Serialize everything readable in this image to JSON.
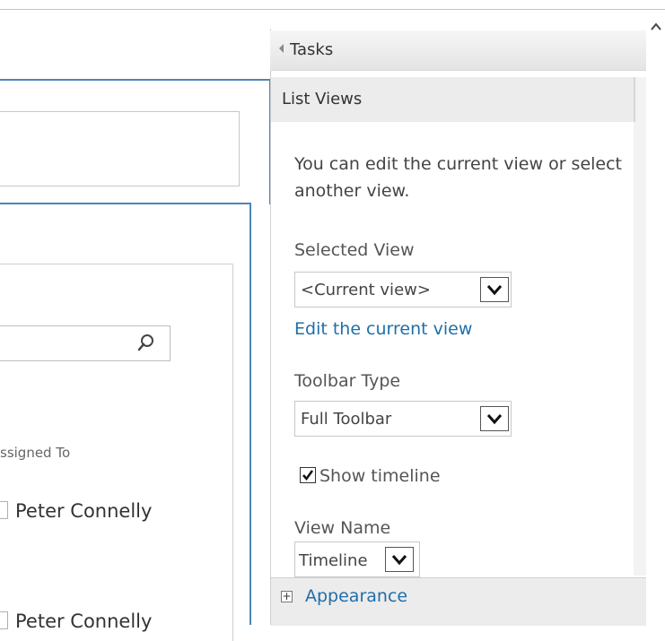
{
  "left": {
    "column_header": "ssigned To",
    "rows": [
      "Peter Connelly",
      "Peter Connelly"
    ]
  },
  "pane": {
    "title": "Tasks",
    "section_title": "List Views",
    "description": "You can edit the current view or select another view.",
    "selected_view_label": "Selected View",
    "selected_view_value": "<Current view>",
    "edit_link": "Edit the current view",
    "toolbar_type_label": "Toolbar Type",
    "toolbar_type_value": "Full Toolbar",
    "show_timeline_label": "Show timeline",
    "show_timeline_checked": true,
    "view_name_label": "View Name",
    "view_name_value": "Timeline",
    "appearance_label": "Appearance",
    "expand_symbol": "+"
  },
  "icons": {
    "search": "search-icon",
    "dropdown": "chevron-down-icon",
    "collapse": "triangle-left-icon",
    "scroll_up": "chevron-up-icon"
  },
  "colors": {
    "accent_blue": "#1e6fa8",
    "frame_blue": "#4a86b8"
  }
}
